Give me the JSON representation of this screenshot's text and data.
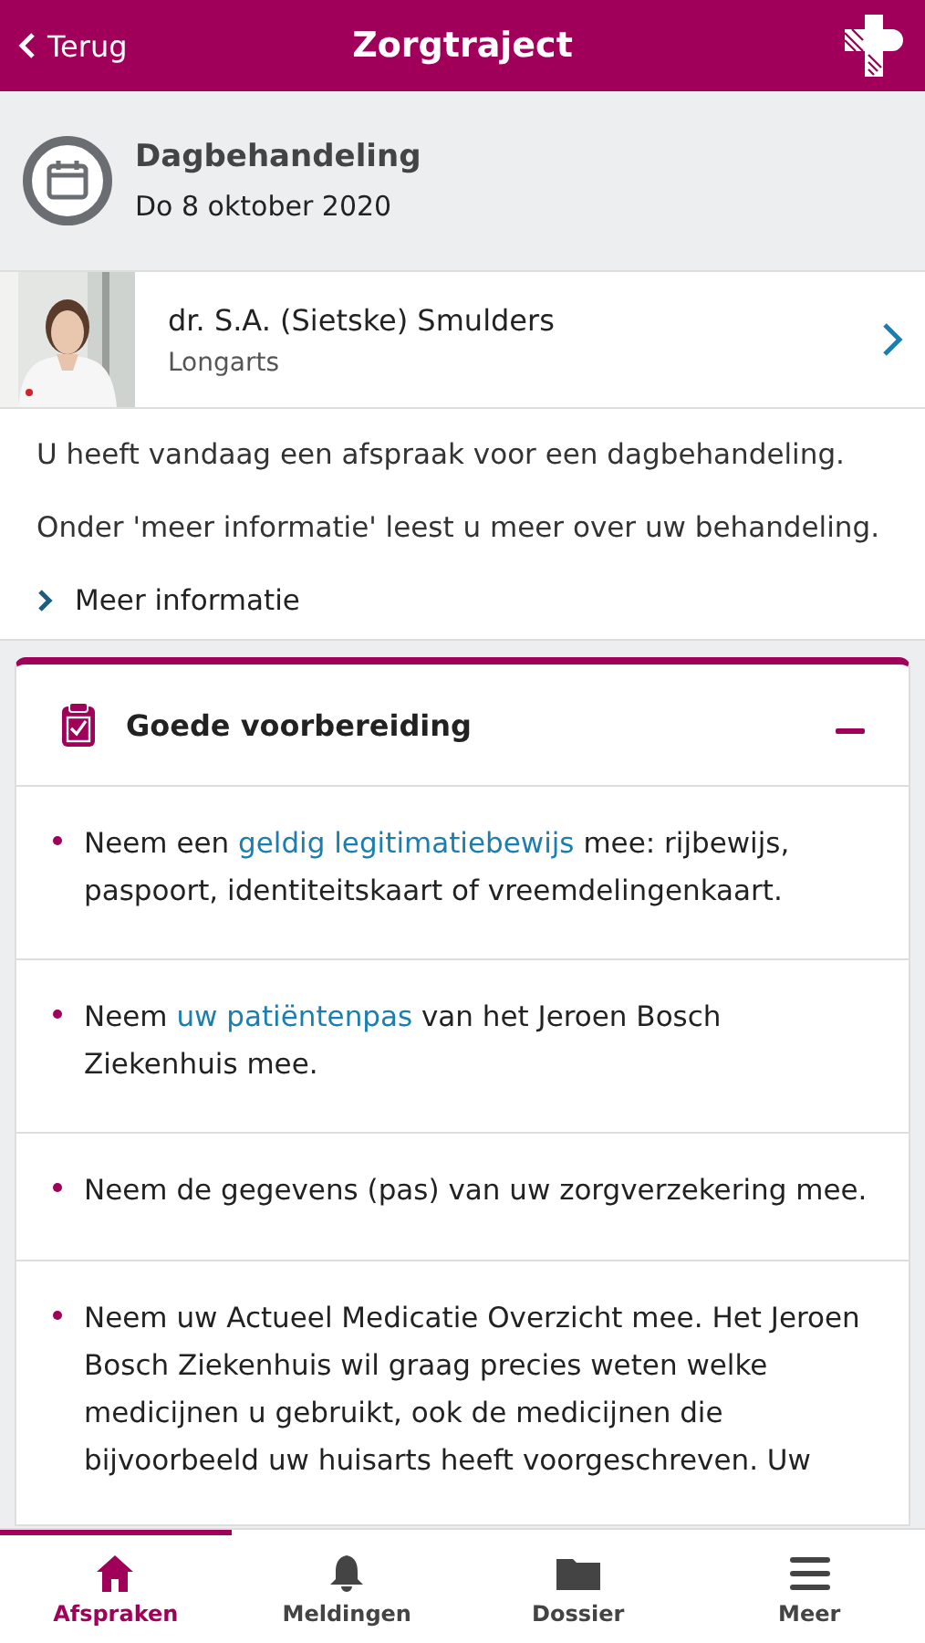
{
  "header": {
    "back": "Terug",
    "title": "Zorgtraject"
  },
  "appointment": {
    "title": "Dagbehandeling",
    "date": "Do 8 oktober 2020"
  },
  "doctor": {
    "name": "dr. S.A. (Sietske) Smulders",
    "role": "Longarts"
  },
  "intro": [
    "U heeft vandaag een afspraak voor een dagbehandeling.",
    "Onder 'meer informatie' leest u meer over uw behandeling."
  ],
  "more_link": "Meer informatie",
  "section": {
    "title": "Goede voorbereiding",
    "expanded": true,
    "items": [
      {
        "before": "Neem een ",
        "link": "geldig legitimatiebewijs",
        "after": " mee: rijbewijs, paspoort, identiteitskaart of vreemdelingenkaart."
      },
      {
        "before": "Neem ",
        "link": "uw patiëntenpas",
        "after": " van het Jeroen Bosch Ziekenhuis mee."
      },
      {
        "before": "Neem de gegevens (pas) van uw zorgverzekering mee."
      },
      {
        "before": "Neem uw Actueel Medicatie Overzicht mee. Het Jeroen Bosch Ziekenhuis wil graag precies weten welke medicijnen u gebruikt, ook de medicijnen die bijvoorbeeld uw huisarts heeft voorgeschreven. Uw"
      }
    ]
  },
  "tabs": [
    {
      "label": "Afspraken",
      "kind": "home",
      "selected": true
    },
    {
      "label": "Meldingen",
      "kind": "bell",
      "selected": false
    },
    {
      "label": "Dossier",
      "kind": "folder",
      "selected": false
    },
    {
      "label": "Meer",
      "kind": "menu",
      "selected": false
    }
  ]
}
